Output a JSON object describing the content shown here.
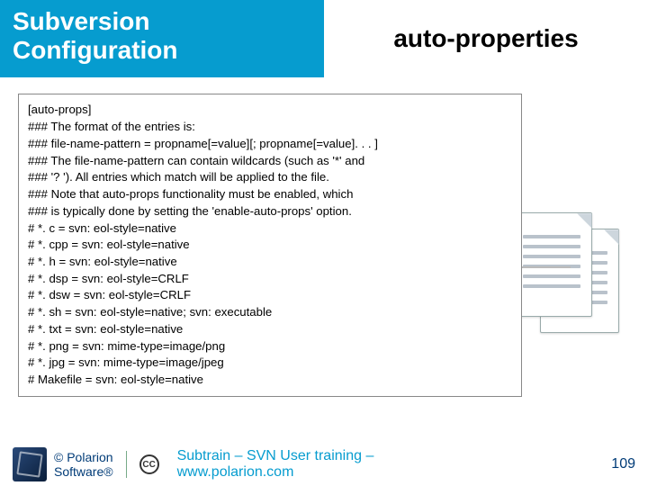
{
  "header": {
    "left_title": "Subversion Configuration",
    "right_title": "auto-properties"
  },
  "code_lines": [
    "[auto-props]",
    "### The format of the entries is:",
    "###   file-name-pattern = propname[=value][; propname[=value]. . . ]",
    "### The file-name-pattern can contain wildcards (such as '*' and",
    "### '? ').  All entries which match will be applied to the file.",
    "### Note that auto-props functionality must be enabled, which",
    "### is typically done by setting the 'enable-auto-props' option.",
    "# *. c = svn: eol-style=native",
    "# *. cpp = svn: eol-style=native",
    "# *. h = svn: eol-style=native",
    "# *. dsp = svn: eol-style=CRLF",
    "# *. dsw = svn: eol-style=CRLF",
    "# *. sh = svn: eol-style=native; svn: executable",
    "# *. txt = svn: eol-style=native",
    "# *. png = svn: mime-type=image/png",
    "# *. jpg = svn: mime-type=image/jpeg",
    "# Makefile = svn: eol-style=native"
  ],
  "footer": {
    "copyright": "© Polarion\nSoftware®",
    "cc_label": "CC",
    "subtrain": "Subtrain – SVN User training –\nwww.polarion.com",
    "page_number": "109"
  }
}
